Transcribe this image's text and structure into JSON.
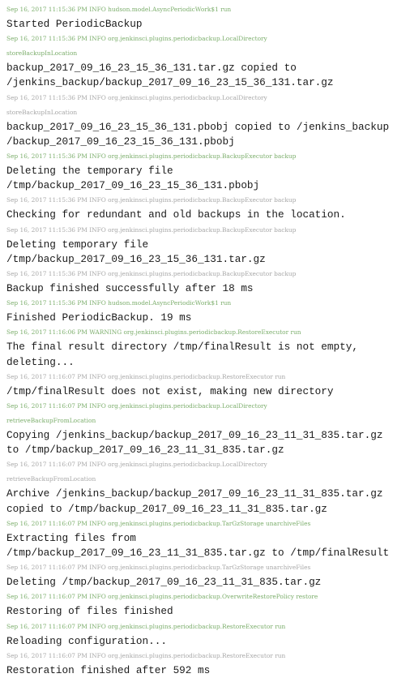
{
  "log": {
    "entries": [
      {
        "meta": [
          "Sep 16, 2017 11:15:36 PM INFO hudson.model.AsyncPeriodicWork$1 run"
        ],
        "tone": "green",
        "message": [
          "Started PeriodicBackup"
        ]
      },
      {
        "meta": [
          "Sep 16, 2017 11:15:36 PM INFO org.jenkinsci.plugins.periodicbackup.LocalDirectory",
          "storeBackupInLocation"
        ],
        "tone": "green",
        "message": [
          "backup_2017_09_16_23_15_36_131.tar.gz copied to",
          "/jenkins_backup/backup_2017_09_16_23_15_36_131.tar.gz"
        ]
      },
      {
        "meta": [
          "Sep 16, 2017 11:15:36 PM INFO org.jenkinsci.plugins.periodicbackup.LocalDirectory",
          "storeBackupInLocation"
        ],
        "tone": "grey",
        "message": [
          "backup_2017_09_16_23_15_36_131.pbobj copied to /jenkins_backup",
          "/backup_2017_09_16_23_15_36_131.pbobj"
        ]
      },
      {
        "meta": [
          "Sep 16, 2017 11:15:36 PM INFO org.jenkinsci.plugins.periodicbackup.BackupExecutor backup"
        ],
        "tone": "green",
        "message": [
          "Deleting the temporary file",
          "/tmp/backup_2017_09_16_23_15_36_131.pbobj"
        ]
      },
      {
        "meta": [
          "Sep 16, 2017 11:15:36 PM INFO org.jenkinsci.plugins.periodicbackup.BackupExecutor backup"
        ],
        "tone": "grey",
        "message": [
          "Checking for redundant and old backups in the location."
        ]
      },
      {
        "meta": [
          "Sep 16, 2017 11:15:36 PM INFO org.jenkinsci.plugins.periodicbackup.BackupExecutor backup"
        ],
        "tone": "grey",
        "message": [
          "Deleting temporary file",
          "/tmp/backup_2017_09_16_23_15_36_131.tar.gz"
        ]
      },
      {
        "meta": [
          "Sep 16, 2017 11:15:36 PM INFO org.jenkinsci.plugins.periodicbackup.BackupExecutor backup"
        ],
        "tone": "grey",
        "message": [
          "Backup finished successfully after 18 ms"
        ]
      },
      {
        "meta": [
          "Sep 16, 2017 11:15:36 PM INFO hudson.model.AsyncPeriodicWork$1 run"
        ],
        "tone": "green",
        "message": [
          "Finished PeriodicBackup. 19 ms"
        ]
      },
      {
        "meta": [
          "Sep 16, 2017 11:16:06 PM WARNING org.jenkinsci.plugins.periodicbackup.RestoreExecutor run"
        ],
        "tone": "green",
        "message": [
          "The final result directory /tmp/finalResult is not empty,",
          "deleting..."
        ]
      },
      {
        "meta": [
          "Sep 16, 2017 11:16:07 PM INFO org.jenkinsci.plugins.periodicbackup.RestoreExecutor run"
        ],
        "tone": "grey",
        "message": [
          "/tmp/finalResult does not exist, making new directory"
        ]
      },
      {
        "meta": [
          "Sep 16, 2017 11:16:07 PM INFO org.jenkinsci.plugins.periodicbackup.LocalDirectory",
          "retrieveBackupFromLocation"
        ],
        "tone": "green",
        "message": [
          "Copying /jenkins_backup/backup_2017_09_16_23_11_31_835.tar.gz",
          "to /tmp/backup_2017_09_16_23_11_31_835.tar.gz"
        ]
      },
      {
        "meta": [
          "Sep 16, 2017 11:16:07 PM INFO org.jenkinsci.plugins.periodicbackup.LocalDirectory",
          "retrieveBackupFromLocation"
        ],
        "tone": "grey",
        "message": [
          "Archive /jenkins_backup/backup_2017_09_16_23_11_31_835.tar.gz",
          "copied to /tmp/backup_2017_09_16_23_11_31_835.tar.gz"
        ]
      },
      {
        "meta": [
          "Sep 16, 2017 11:16:07 PM INFO org.jenkinsci.plugins.periodicbackup.TarGzStorage unarchiveFiles"
        ],
        "tone": "green",
        "message": [
          "Extracting files from",
          "/tmp/backup_2017_09_16_23_11_31_835.tar.gz to /tmp/finalResult"
        ]
      },
      {
        "meta": [
          "Sep 16, 2017 11:16:07 PM INFO org.jenkinsci.plugins.periodicbackup.TarGzStorage unarchiveFiles"
        ],
        "tone": "grey",
        "message": [
          "Deleting /tmp/backup_2017_09_16_23_11_31_835.tar.gz"
        ]
      },
      {
        "meta": [
          "Sep 16, 2017 11:16:07 PM INFO org.jenkinsci.plugins.periodicbackup.OverwriteRestorePolicy restore"
        ],
        "tone": "green",
        "message": [
          "Restoring of files finished"
        ]
      },
      {
        "meta": [
          "Sep 16, 2017 11:16:07 PM INFO org.jenkinsci.plugins.periodicbackup.RestoreExecutor run"
        ],
        "tone": "green",
        "message": [
          "Reloading configuration..."
        ]
      },
      {
        "meta": [
          "Sep 16, 2017 11:16:07 PM INFO org.jenkinsci.plugins.periodicbackup.RestoreExecutor run"
        ],
        "tone": "grey",
        "message": [
          "Restoration finished after 592 ms"
        ]
      }
    ]
  },
  "colors": {
    "meta_grey": "#a8a8a8",
    "meta_green": "#7cae6c",
    "message_text": "#1a1a1a",
    "background": "#ffffff"
  }
}
